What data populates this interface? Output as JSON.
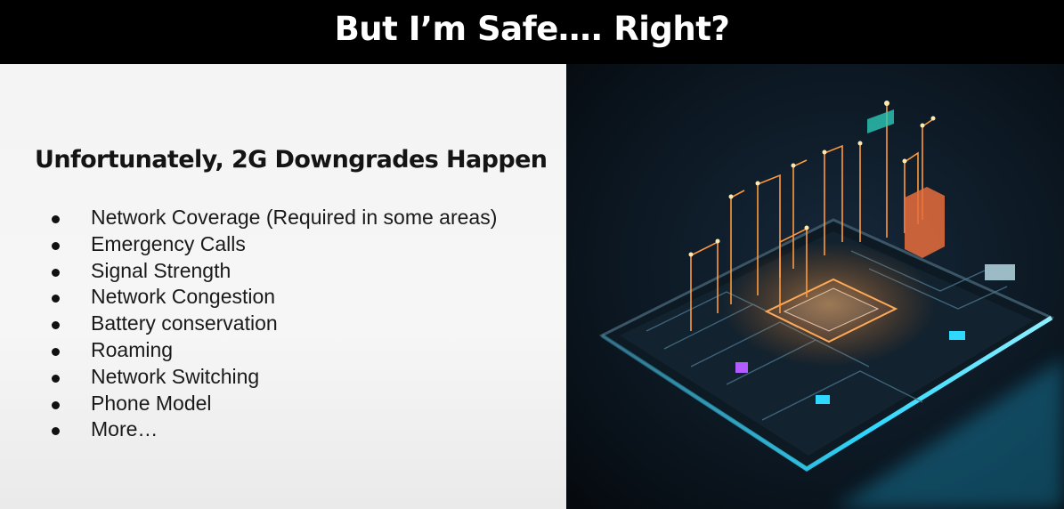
{
  "slide": {
    "title": "But I’m Safe…. Right?",
    "heading": "Unfortunately, 2G Downgrades Happen",
    "bullets": [
      "Network Coverage (Required in some areas)",
      "Emergency Calls",
      "Signal Strength",
      "Network Congestion",
      "Battery conservation",
      "Roaming",
      "Network Switching",
      "Phone Model",
      "More…"
    ]
  },
  "image": {
    "subject": "smartphone-circuit-illustration",
    "colors": {
      "background": "#0b1620",
      "glow_cyan": "#2fd8ff",
      "circuit_orange": "#ff9a3c",
      "accent_purple": "#b25cff"
    }
  }
}
